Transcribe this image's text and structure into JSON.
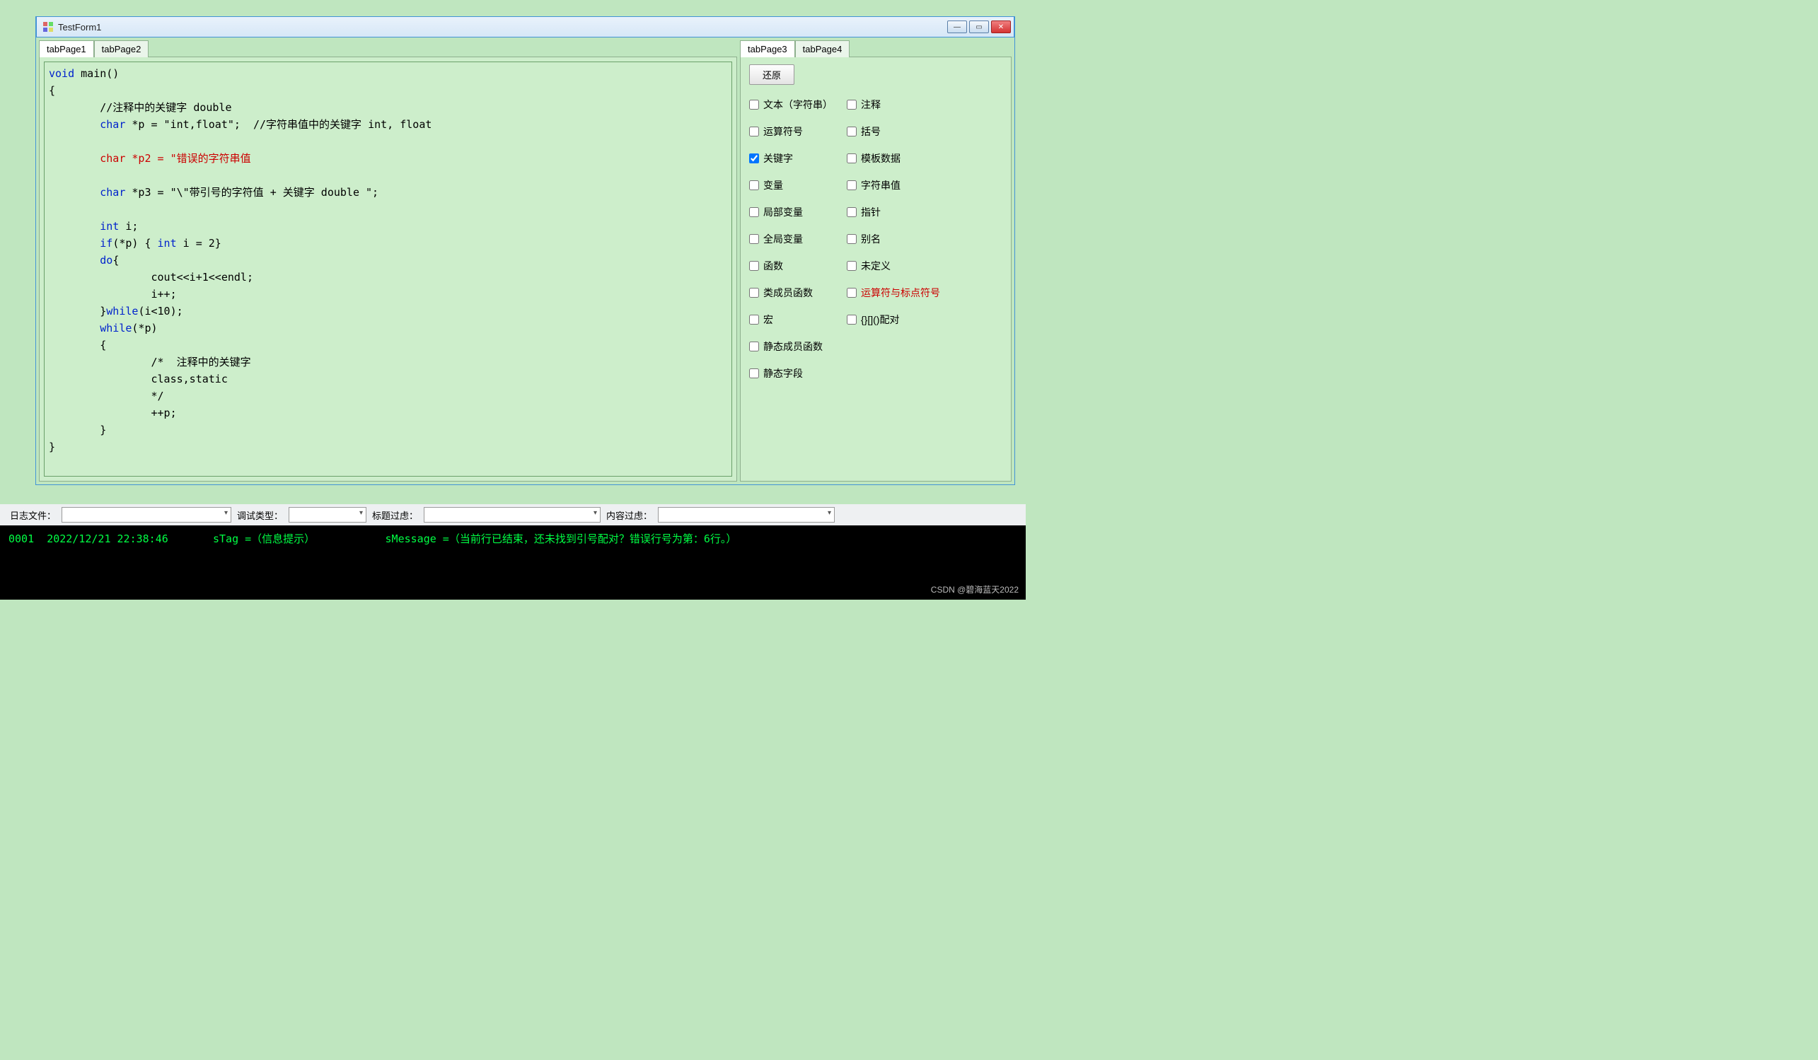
{
  "window": {
    "title": "TestForm1"
  },
  "leftTabs": {
    "active": "tabPage1",
    "inactive": "tabPage2"
  },
  "rightTabs": {
    "active": "tabPage3",
    "inactive": "tabPage4"
  },
  "code": {
    "l1a": "void",
    "l1b": " main()",
    "l2": "{",
    "l3": "        //注释中的关键字 double",
    "l4a": "        char",
    "l4b": " *p = \"int,float\";  //字符串值中的关键字 int, float",
    "l5a": "        char",
    "l5b": " *p2 = \"错误的字符串值",
    "l6a": "        char",
    "l6b": " *p3 = \"\\\"带引号的字符值 + 关键字 double \";",
    "l7a": "        int",
    "l7b": " i;",
    "l8a": "        if",
    "l8b": "(*p) { ",
    "l8c": "int",
    "l8d": " i = 2}",
    "l9a": "        do",
    "l9b": "{",
    "l10": "                cout<<i+1<<endl;",
    "l11": "                i++;",
    "l12a": "        }",
    "l12b": "while",
    "l12c": "(i<10);",
    "l13a": "        while",
    "l13b": "(*p)",
    "l14": "        {",
    "l15": "                /*  注释中的关键字",
    "l16": "                class,static",
    "l17": "                */",
    "l18": "                ++p;",
    "l19": "        }",
    "l20": "}"
  },
  "restore": "还原",
  "checksLeft": [
    {
      "label": "文本（字符串）",
      "checked": false
    },
    {
      "label": "运算符号",
      "checked": false
    },
    {
      "label": "关键字",
      "checked": true
    },
    {
      "label": "变量",
      "checked": false
    },
    {
      "label": "局部变量",
      "checked": false
    },
    {
      "label": "全局变量",
      "checked": false
    },
    {
      "label": "函数",
      "checked": false
    },
    {
      "label": "类成员函数",
      "checked": false
    },
    {
      "label": "宏",
      "checked": false
    },
    {
      "label": "静态成员函数",
      "checked": false
    },
    {
      "label": "静态字段",
      "checked": false
    }
  ],
  "checksRight": [
    {
      "label": "注释",
      "checked": false,
      "red": false
    },
    {
      "label": "括号",
      "checked": false,
      "red": false
    },
    {
      "label": "模板数据",
      "checked": false,
      "red": false
    },
    {
      "label": "字符串值",
      "checked": false,
      "red": false
    },
    {
      "label": "指针",
      "checked": false,
      "red": false
    },
    {
      "label": "别名",
      "checked": false,
      "red": false
    },
    {
      "label": "未定义",
      "checked": false,
      "red": false
    },
    {
      "label": "运算符与标点符号",
      "checked": false,
      "red": true
    },
    {
      "label": "{}[]()配对",
      "checked": false,
      "red": false
    }
  ],
  "bottom": {
    "logfile": "日志文件：",
    "debugtype": "调试类型：",
    "titlefilter": "标题过虑：",
    "contentfilter": "内容过虑："
  },
  "console": {
    "idx": "0001",
    "time": "2022/12/21 22:38:46",
    "tag": "sTag =（信息提示）",
    "msg": "sMessage =（当前行已结束，还未找到引号配对？错误行号为第：6行。）"
  },
  "watermark": "CSDN @碧海蓝天2022"
}
